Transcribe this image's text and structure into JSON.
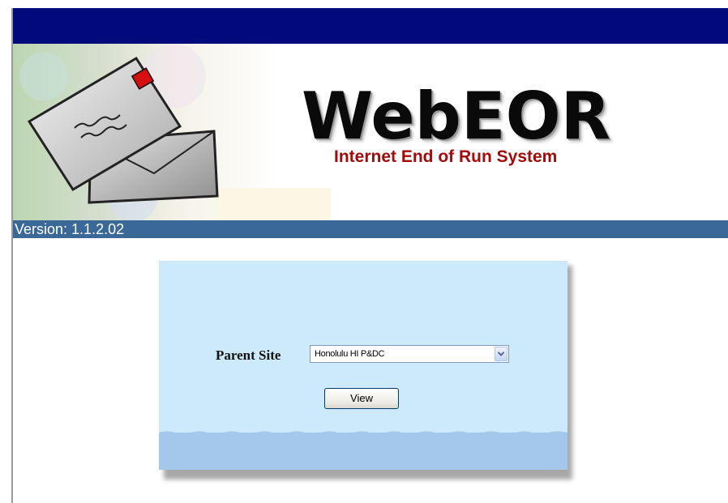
{
  "app": {
    "title": "WebEOR",
    "subtitle": "Internet End of Run System"
  },
  "banner": {
    "art_icon": "envelope-icon"
  },
  "version_bar": {
    "text": "Version: 1.1.2.02"
  },
  "form": {
    "parent_site_label": "Parent Site",
    "parent_site_value": "Honolulu HI P&DC",
    "dropdown_icon": "chevron-down-icon",
    "view_button_label": "View"
  },
  "colors": {
    "top_bar": "#000a7a",
    "version_bar": "#3a6897",
    "panel": "#cdeafc",
    "panel_footer": "#a4c8ec",
    "subtitle": "#a30a0a"
  }
}
